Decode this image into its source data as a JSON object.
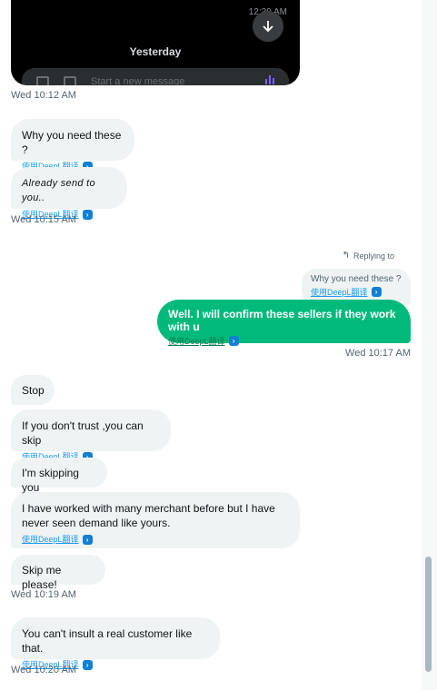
{
  "media": {
    "timestamp": "12:39 AM",
    "divider": "Yesterday",
    "composer_placeholder": "Start a new message"
  },
  "messages": [
    {
      "kind": "stamp",
      "text": "Wed 10:12 AM"
    },
    {
      "kind": "in",
      "text": "Why you need these ?",
      "translate": "使用DeepL翻译"
    },
    {
      "kind": "in",
      "text": "Already send to you..",
      "translate": "使用DeepL翻译"
    },
    {
      "kind": "stamp",
      "text": "Wed 10:15 AM"
    },
    {
      "kind": "reply",
      "text": "Replying to"
    },
    {
      "kind": "quoted",
      "text": "Why you need these ?",
      "translate": "使用DeepL翻译"
    },
    {
      "kind": "out",
      "text": "Well. I will confirm these sellers if they work with u",
      "translate": "使用DeepL翻译"
    },
    {
      "kind": "stamp",
      "text": "Wed 10:17 AM"
    },
    {
      "kind": "in",
      "text": "Stop"
    },
    {
      "kind": "in",
      "text": "If you don't trust ,you can skip",
      "translate": "使用DeepL翻译"
    },
    {
      "kind": "in",
      "text": "I'm skipping you"
    },
    {
      "kind": "in",
      "text": "I have worked with many merchant before but I have never seen demand like yours.",
      "translate": "使用DeepL翻译"
    },
    {
      "kind": "in",
      "text": "Skip me please!"
    },
    {
      "kind": "stamp",
      "text": "Wed 10:19 AM"
    },
    {
      "kind": "in",
      "text": "You can't insult a real customer like that.",
      "translate": "使用DeepL翻译"
    },
    {
      "kind": "stamp",
      "text": "Wed 10:20 AM"
    }
  ],
  "colors": {
    "outgoing": "#00ba7c",
    "incoming": "#eff3f4",
    "link": "#1d9bf0"
  },
  "icons": [
    "arrow-down-icon",
    "image-icon",
    "gif-icon",
    "audio-icon",
    "reply-arrow-icon",
    "deepl-icon"
  ]
}
